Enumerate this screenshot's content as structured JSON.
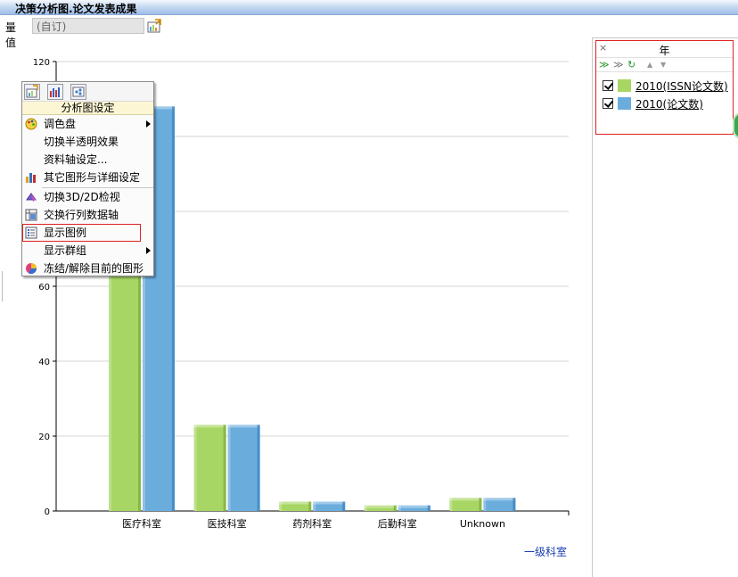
{
  "window": {
    "title": "决策分析图.论文发表成果"
  },
  "measure": {
    "label": "量值",
    "value": "(自订)"
  },
  "colors": {
    "series1": "#a8d665",
    "series1_dark": "#7fb03c",
    "series2": "#6aaddd",
    "series2_dark": "#3f86bf"
  },
  "icons": {
    "measure_setting": "chart-settings-icon"
  },
  "chart_data": {
    "type": "bar",
    "categories": [
      "医疗科室",
      "医技科室",
      "药剂科室",
      "后勤科室",
      "Unknown"
    ],
    "series": [
      {
        "name": "2010(ISSN论文数)",
        "values": [
          108,
          23,
          2.5,
          1.5,
          3.5
        ]
      },
      {
        "name": "2010(论文数)",
        "values": [
          108,
          23,
          2.5,
          1.5,
          3.5
        ]
      }
    ],
    "ylim": [
      0,
      120
    ],
    "yticks": [
      0,
      20,
      40,
      60,
      80,
      100,
      120
    ],
    "xlabel": "一级科室",
    "grid": true,
    "legend": "right-panel"
  },
  "context_menu": {
    "header": "分析图设定",
    "items": [
      {
        "label": "调色盘",
        "submenu": true,
        "icon": "palette-icon"
      },
      {
        "label": "切换半透明效果",
        "submenu": false,
        "icon": ""
      },
      {
        "label": "资料轴设定...",
        "submenu": false,
        "icon": ""
      },
      {
        "label": "其它图形与详细设定",
        "submenu": false,
        "icon": "bar-chart-icon"
      },
      {
        "label": "切换3D/2D检视",
        "submenu": false,
        "icon": "3d-view-icon"
      },
      {
        "label": "交换行列数据轴",
        "submenu": false,
        "icon": "swap-axis-icon"
      },
      {
        "label": "显示图例",
        "submenu": false,
        "icon": "legend-icon"
      },
      {
        "label": "显示群组",
        "submenu": true,
        "icon": ""
      },
      {
        "label": "冻结/解除目前的图形",
        "submenu": false,
        "icon": "freeze-icon"
      }
    ]
  },
  "legend": {
    "close": "×",
    "title": "年",
    "tools": [
      "≫",
      "≫",
      "↻",
      "▲",
      "▼"
    ],
    "items": [
      {
        "label": "2010(ISSN论文数)",
        "checked": true
      },
      {
        "label": "2010(论文数)",
        "checked": true
      }
    ]
  }
}
